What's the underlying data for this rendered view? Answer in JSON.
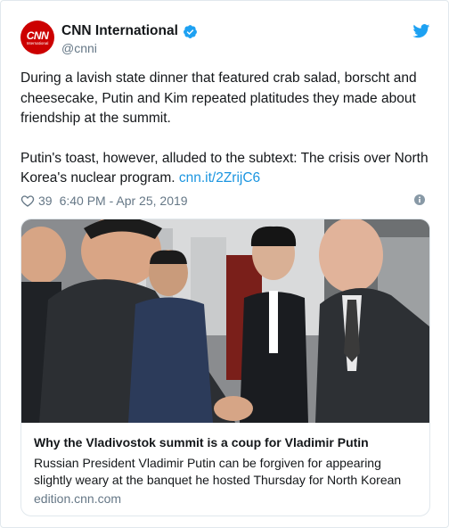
{
  "account": {
    "display_name": "CNN International",
    "handle": "@cnni",
    "avatar_text": "CNN",
    "avatar_subtext": "International",
    "verified": true,
    "brand_color": "#cc0000"
  },
  "tweet": {
    "paragraph1": "During a lavish state dinner that featured crab salad, borscht and cheesecake, Putin and Kim repeated platitudes they made about friendship at the summit.",
    "paragraph2": "Putin's toast, however, alluded to the subtext: The crisis over North Korea's nuclear program.",
    "link": "cnn.it/2ZrijC6",
    "link_color": "#1b95e0"
  },
  "meta": {
    "likes": "39",
    "timestamp": "6:40 PM - Apr 25, 2019"
  },
  "card": {
    "title": "Why the Vladivostok summit is a coup for Vladimir Putin",
    "description": "Russian President Vladimir Putin can be forgiven for appearing slightly weary at the banquet he hosted Thursday for North Korean",
    "domain": "edition.cnn.com",
    "image_alt": "Kim Jong Un shaking hands with Vladimir Putin"
  },
  "icons": {
    "verified": "verified-badge-icon",
    "bird": "twitter-bird-icon",
    "heart": "heart-icon",
    "info": "info-icon"
  }
}
